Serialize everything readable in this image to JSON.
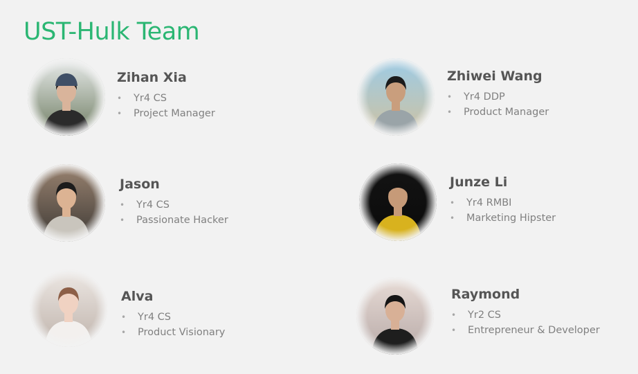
{
  "title": "UST-Hulk Team",
  "colors": {
    "title": "#2bb673",
    "name": "#555555",
    "bullet_text": "#808080",
    "background": "#f2f2f2"
  },
  "bullet_glyph": "•",
  "members": [
    {
      "name": "Zihan Xia",
      "photo_icon": "person-photo",
      "bullets": [
        "Yr4 CS",
        "Project Manager"
      ],
      "colors": {
        "bg1": "#e9ecec",
        "bg2": "#6f7d62",
        "shirt": "#2b2b2b",
        "skin": "#d9b49b",
        "hair": "#1e1a1a",
        "hat": "#3f4f66"
      }
    },
    {
      "name": "Zhiwei Wang",
      "photo_icon": "person-photo",
      "bullets": [
        "Yr4 DDP",
        "Product Manager"
      ],
      "colors": {
        "bg1": "#9ccbe6",
        "bg2": "#cfc2a1",
        "shirt": "#9aa4a8",
        "skin": "#c99e7d",
        "hair": "#1b1b1b"
      }
    },
    {
      "name": "Jason",
      "photo_icon": "person-photo",
      "bullets": [
        "Yr4 CS",
        "Passionate Hacker"
      ],
      "colors": {
        "bg1": "#9a8370",
        "bg2": "#3e3a36",
        "shirt": "#c9c5bd",
        "skin": "#dcb393",
        "hair": "#1c1c1c"
      }
    },
    {
      "name": "Junze Li",
      "photo_icon": "person-photo",
      "bullets": [
        "Yr4 RMBI",
        "Marketing Hipster"
      ],
      "colors": {
        "bg1": "#141414",
        "bg2": "#0a0a0a",
        "shirt": "#d8b21e",
        "skin": "#c69a78",
        "hair": "#111111"
      }
    },
    {
      "name": "Alva",
      "photo_icon": "person-photo",
      "bullets": [
        "Yr4 CS",
        "Product Visionary"
      ],
      "colors": {
        "bg1": "#ede8e4",
        "bg2": "#bfb3ab",
        "shirt": "#f3f0ee",
        "skin": "#f0d2c2",
        "hair": "#8d5f47"
      }
    },
    {
      "name": "Raymond",
      "photo_icon": "person-photo",
      "bullets": [
        "Yr2 CS",
        "Entrepreneur & Developer"
      ],
      "colors": {
        "bg1": "#e8dcd6",
        "bg2": "#b7a9a7",
        "shirt": "#1e1e1e",
        "skin": "#d8b096",
        "hair": "#151515"
      }
    }
  ]
}
